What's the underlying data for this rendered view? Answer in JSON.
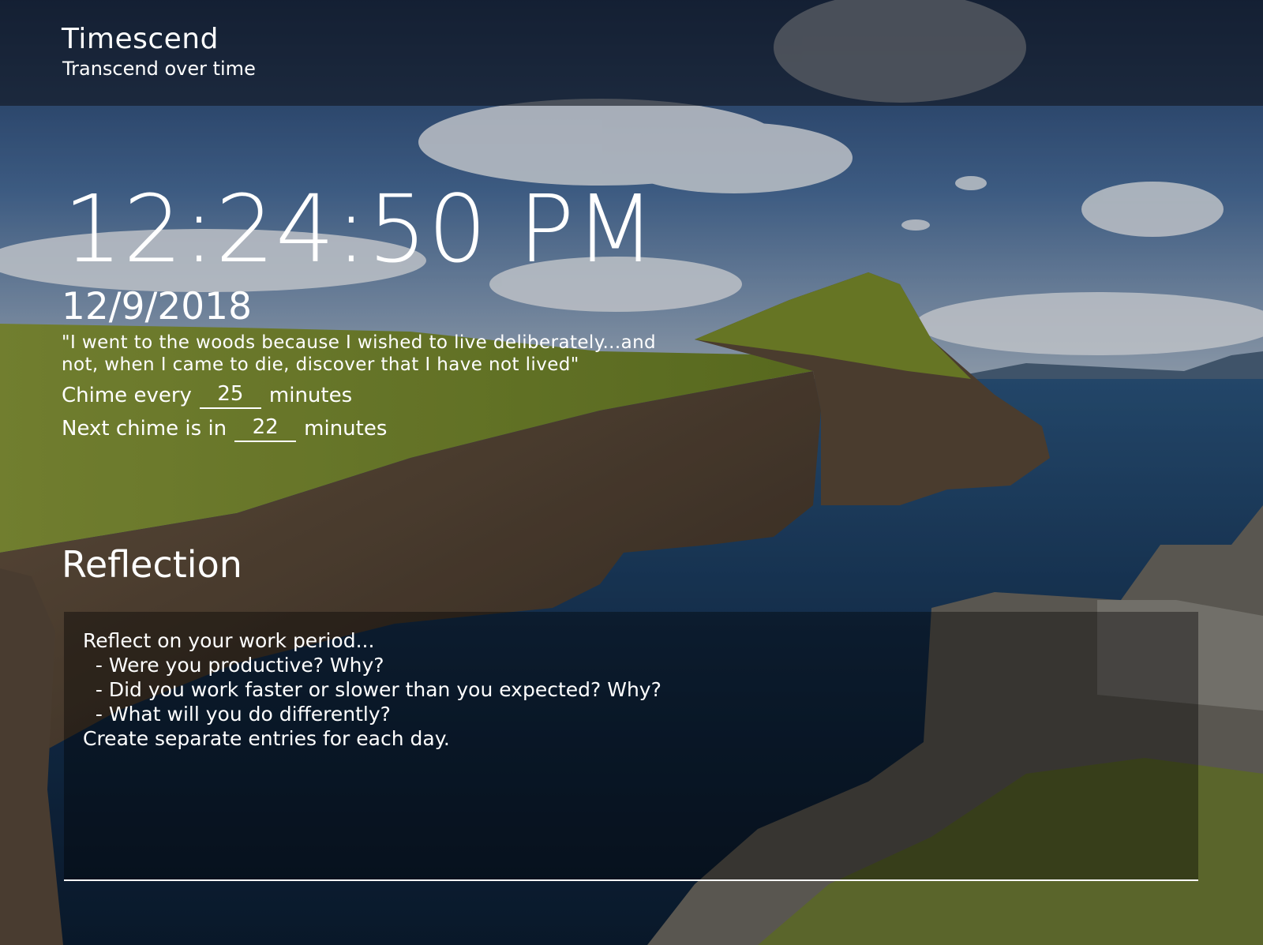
{
  "header": {
    "title": "Timescend",
    "subtitle": "Transcend over time"
  },
  "clock": {
    "time": "12:24:50 PM",
    "date": "12/9/2018"
  },
  "quote": "\"I went to the woods because I wished to live deliberately...and not, when I came to die, discover that I have not lived\"",
  "chime": {
    "prefix": "Chime every",
    "interval_value": "25",
    "suffix": "minutes"
  },
  "next_chime": {
    "prefix": "Next chime is in",
    "value": "22",
    "suffix": "minutes"
  },
  "reflection": {
    "heading": "Reflection",
    "text": "Reflect on your work period...\n  - Were you productive? Why?\n  - Did you work faster or slower than you expected? Why?\n  - What will you do differently?\nCreate separate entries for each day."
  },
  "background": {
    "description_icon": "landscape-image",
    "sky_color": "#3a5d8f",
    "water_color": "#14304d",
    "cliff_color": "#4a3c30",
    "grass_color": "#7a8f2e"
  }
}
